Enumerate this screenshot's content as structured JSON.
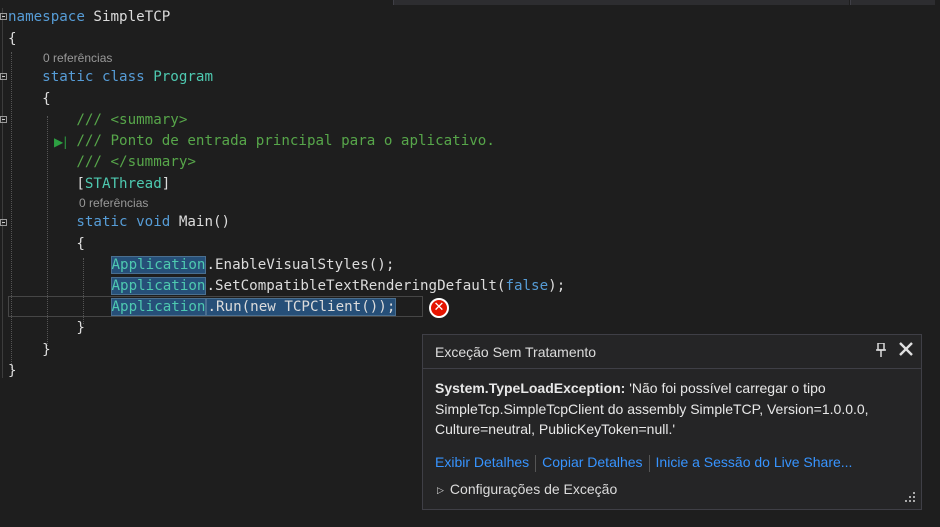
{
  "colors": {
    "keyword": "#569cd6",
    "type": "#4ec9b0",
    "comment": "#57a64a",
    "text": "#dcdcdc",
    "link": "#3794ff",
    "error": "#e51400"
  },
  "code": {
    "line1": {
      "kw": "namespace",
      "rest": " SimpleTCP"
    },
    "line2": "{",
    "ref1": "0 referências",
    "line3": {
      "kw": "static class",
      "type": "Program"
    },
    "line4": "{",
    "line5": "/// <summary>",
    "line6": "/// Ponto de entrada principal para o aplicativo.",
    "line7": "/// </summary>",
    "line8": {
      "open": "[",
      "attr": "STAThread",
      "close": "]"
    },
    "ref2": "0 referências",
    "line9": {
      "kw": "static void",
      "rest": " Main()"
    },
    "line10": "{",
    "line11": {
      "type": "Application",
      "rest": ".EnableVisualStyles();"
    },
    "line12": {
      "type": "Application",
      "rest": ".SetCompatibleTextRenderingDefault(",
      "kw": "false",
      "end": ");"
    },
    "line13": {
      "type": "Application",
      "rest": ".Run(new TCPClient());"
    },
    "line14": "}",
    "line15": "}",
    "line16": "}"
  },
  "exception_popup": {
    "title": "Exceção Sem Tratamento",
    "exception_type": "System.TypeLoadException:",
    "message": " 'Não foi possível carregar o tipo SimpleTcp.SimpleTcpClient do assembly SimpleTCP, Version=1.0.0.0, Culture=neutral, PublicKeyToken=null.'",
    "link_details": "Exibir Detalhes",
    "link_copy": "Copiar Detalhes",
    "link_liveshare": "Inicie a Sessão do Live Share...",
    "settings": "Configurações de Exceção",
    "pin_icon": "pin-icon",
    "close_icon": "close-icon"
  },
  "error_glyph": "error-icon"
}
